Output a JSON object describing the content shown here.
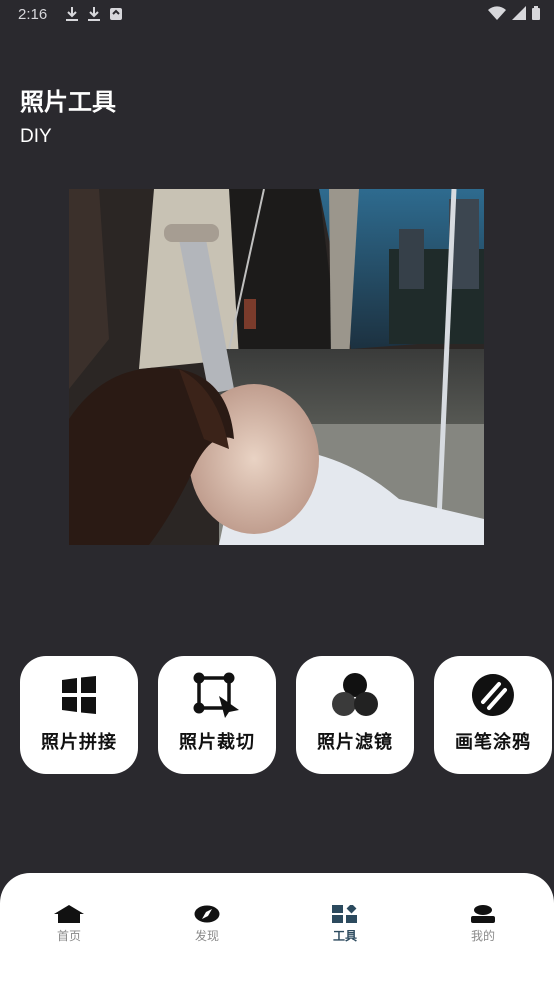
{
  "status": {
    "time": "2:16"
  },
  "header": {
    "title": "照片工具",
    "subtitle": "DIY"
  },
  "tools": [
    {
      "label": "照片拼接",
      "icon": "grid-icon"
    },
    {
      "label": "照片裁切",
      "icon": "crop-icon"
    },
    {
      "label": "照片滤镜",
      "icon": "filter-circles-icon"
    },
    {
      "label": "画笔涂鸦",
      "icon": "brush-icon"
    }
  ],
  "nav": [
    {
      "label": "首页",
      "icon": "home-icon"
    },
    {
      "label": "发现",
      "icon": "compass-icon"
    },
    {
      "label": "工具",
      "icon": "tools-icon",
      "active": true
    },
    {
      "label": "我的",
      "icon": "user-icon"
    }
  ],
  "colors": {
    "background": "#2a292e",
    "active_nav": "#2c4a5e"
  }
}
